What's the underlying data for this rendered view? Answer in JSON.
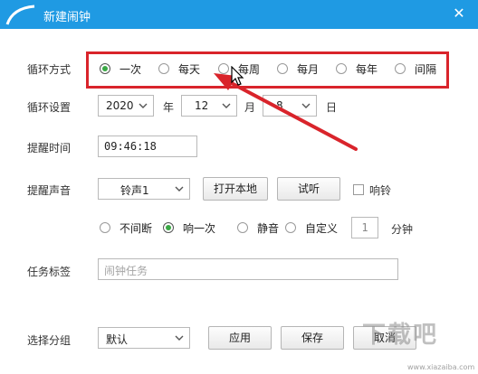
{
  "window": {
    "title": "新建闹钟",
    "close_glyph": "✕"
  },
  "labels": {
    "loop_mode": "循环方式",
    "loop_settings": "循环设置",
    "remind_time": "提醒时间",
    "remind_sound": "提醒声音",
    "task_label": "任务标签",
    "select_group": "选择分组"
  },
  "loop_modes": [
    {
      "label": "一次",
      "checked": true
    },
    {
      "label": "每天",
      "checked": false
    },
    {
      "label": "每周",
      "checked": false
    },
    {
      "label": "每月",
      "checked": false
    },
    {
      "label": "每年",
      "checked": false
    },
    {
      "label": "间隔",
      "checked": false
    }
  ],
  "loop_settings": {
    "year": "2020",
    "year_unit": "年",
    "month": "12",
    "month_unit": "月",
    "day": "8",
    "day_unit": "日"
  },
  "remind_time": {
    "value": "09:46:18"
  },
  "sound": {
    "selected": "铃声1",
    "open_local": "打开本地",
    "preview": "试听",
    "ring_label": "响铃",
    "ring_checked": false
  },
  "play_modes": [
    {
      "label": "不间断",
      "checked": false
    },
    {
      "label": "响一次",
      "checked": true
    },
    {
      "label": "静音",
      "checked": false
    },
    {
      "label": "自定义",
      "checked": false
    }
  ],
  "custom_minutes": {
    "value": "1",
    "unit": "分钟"
  },
  "task_label": {
    "placeholder": "闹钟任务"
  },
  "group": {
    "selected": "默认",
    "apply": "应用",
    "save": "保存",
    "cancel": "取消"
  },
  "watermark": {
    "text": "下载吧",
    "url": "www.xiazaiba.com"
  },
  "colors": {
    "titlebar": "#1f9ae3",
    "annotation": "#d9242b",
    "radio_checked": "#3aa845"
  }
}
